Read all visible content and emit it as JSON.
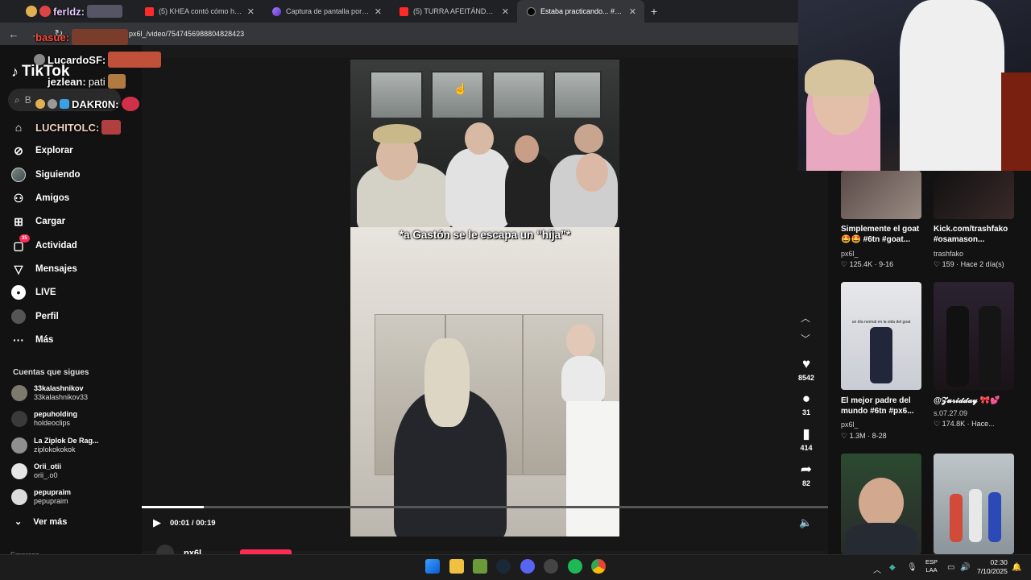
{
  "browser": {
    "tabs": [
      {
        "label": "(5) KHEA contó cómo hizo su h",
        "icon": "youtube-icon"
      },
      {
        "label": "Captura de pantalla por Lightsh",
        "icon": "lightshot-icon"
      },
      {
        "label": "(5) TURRA AFEITÁNDOSE EL BIG",
        "icon": "youtube-icon"
      },
      {
        "label": "Estaba practicando... #px6 #6tn",
        "icon": "tiktok-icon",
        "active": true
      }
    ],
    "url": "px6l_/video/7547456988804828423",
    "new_tab": "+"
  },
  "chat": [
    {
      "user": "ferldz:",
      "msg": ""
    },
    {
      "user": "basue:",
      "msg": ""
    },
    {
      "user": "LucardoSF:",
      "msg": ""
    },
    {
      "user": "jezlean:",
      "msg": "pati"
    },
    {
      "user": "DAKR0N:",
      "msg": ""
    },
    {
      "user": "LUCHITOLC:",
      "msg": ""
    }
  ],
  "tiktok": {
    "logo": "TikTok",
    "search_placeholder": "B",
    "nav": [
      {
        "label": "Explorar",
        "icon": "compass-icon"
      },
      {
        "label": "Siguiendo",
        "icon": "avatar-icon"
      },
      {
        "label": "Amigos",
        "icon": "friends-icon"
      },
      {
        "label": "Cargar",
        "icon": "upload-icon"
      },
      {
        "label": "Actividad",
        "icon": "activity-icon",
        "badge": "35"
      },
      {
        "label": "Mensajes",
        "icon": "send-icon"
      },
      {
        "label": "LIVE",
        "icon": "live-icon"
      },
      {
        "label": "Perfil",
        "icon": "profile-icon"
      },
      {
        "label": "Más",
        "icon": "more-icon"
      }
    ],
    "follows_title": "Cuentas que sigues",
    "follows": [
      {
        "name": "33kalashnikov",
        "handle": "33kalashnikov33"
      },
      {
        "name": "pepuholding",
        "handle": "holdeoclips"
      },
      {
        "name": "La Ziplok De Rag...",
        "handle": "ziplokokokok"
      },
      {
        "name": "Orii_otii",
        "handle": "orii_.o0"
      },
      {
        "name": "pepupraim",
        "handle": "pepupraim"
      }
    ],
    "see_more": "Ver más",
    "footer_partial": "Empresa"
  },
  "player": {
    "caption": "*a Gastón se le escapa un “hija”*",
    "time": "00:01 / 00:19",
    "progress": 0.09,
    "likes": "8542",
    "comments": "31",
    "saves": "414",
    "shares": "82",
    "creator": "px6l_"
  },
  "recommendations": [
    {
      "title": "Simplemente el goat 🤩🤩 #6tn #goat...",
      "author": "px6l_",
      "likes": "125.4K",
      "date": "9-16"
    },
    {
      "title": "Kick.com/trashfako #osamason...",
      "author": "trashfako",
      "likes": "159",
      "date": "Hace 2 día(s)"
    },
    {
      "title": "El mejor padre del mundo #6tn #px6...",
      "author": "px6l_",
      "likes": "1.3M",
      "date": "8-28",
      "thumb_text": "un día normal en la vida del goat"
    },
    {
      "title": "@𝓩𝓾𝓻𝓲𝓭𝓭𝓪𝔂 🎀💕",
      "author": "s.07.27.09",
      "likes": "174.8K",
      "date": "Hace..."
    },
    {
      "title": "",
      "author": "",
      "likes": "",
      "date": ""
    },
    {
      "title": "",
      "author": "",
      "likes": "",
      "date": ""
    }
  ],
  "taskbar": {
    "lang": "ESP",
    "lang2": "LAA",
    "time": "02:30",
    "date": "7/10/2025"
  }
}
